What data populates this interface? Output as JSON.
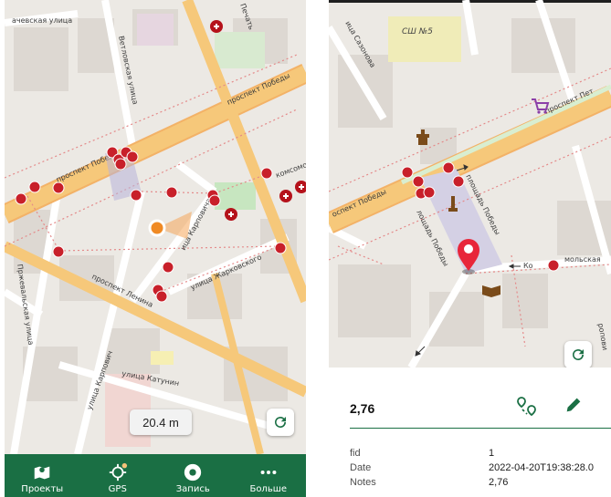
{
  "left_screen": {
    "map": {
      "streets": [
        "ачевская улица",
        "проспект Победы",
        "проспект Победы",
        "Ветловская улица",
        "Печать",
        "комсомольская",
        "Пржевальская улица",
        "проспект Ленина",
        "ица Карповича",
        "улица Жарковского",
        "улица Карпович",
        "улица Катунин"
      ],
      "scale_label": "20.4 m",
      "road_color": "#f6c87a",
      "main_road_color": "#f3b267",
      "vertex_color": "#c8202a"
    },
    "refresh_icon": "refresh-icon",
    "bottom_nav": [
      {
        "label": "Проекты",
        "icon": "map-pin-icon"
      },
      {
        "label": "GPS",
        "icon": "gps-crosshair-icon"
      },
      {
        "label": "Запись",
        "icon": "record-icon"
      },
      {
        "label": "Больше",
        "icon": "more-icon"
      }
    ],
    "nav_color": "#1a6f44"
  },
  "right_screen": {
    "map": {
      "labels": [
        "СШ №5",
        "ица Сазонова",
        "проспект Пет",
        "оспект Победы",
        "площадь Победы",
        "лощадь Победы",
        "Ко",
        "мольская",
        "ропови"
      ]
    },
    "refresh_icon": "refresh-icon",
    "panel": {
      "title": "2,76",
      "actions": [
        "route-icon",
        "pencil-icon"
      ],
      "attributes": [
        {
          "key": "fid",
          "value": "1"
        },
        {
          "key": "Date",
          "value": "2022-04-20T19:38:28.0"
        },
        {
          "key": "Notes",
          "value": "2,76"
        }
      ]
    }
  }
}
